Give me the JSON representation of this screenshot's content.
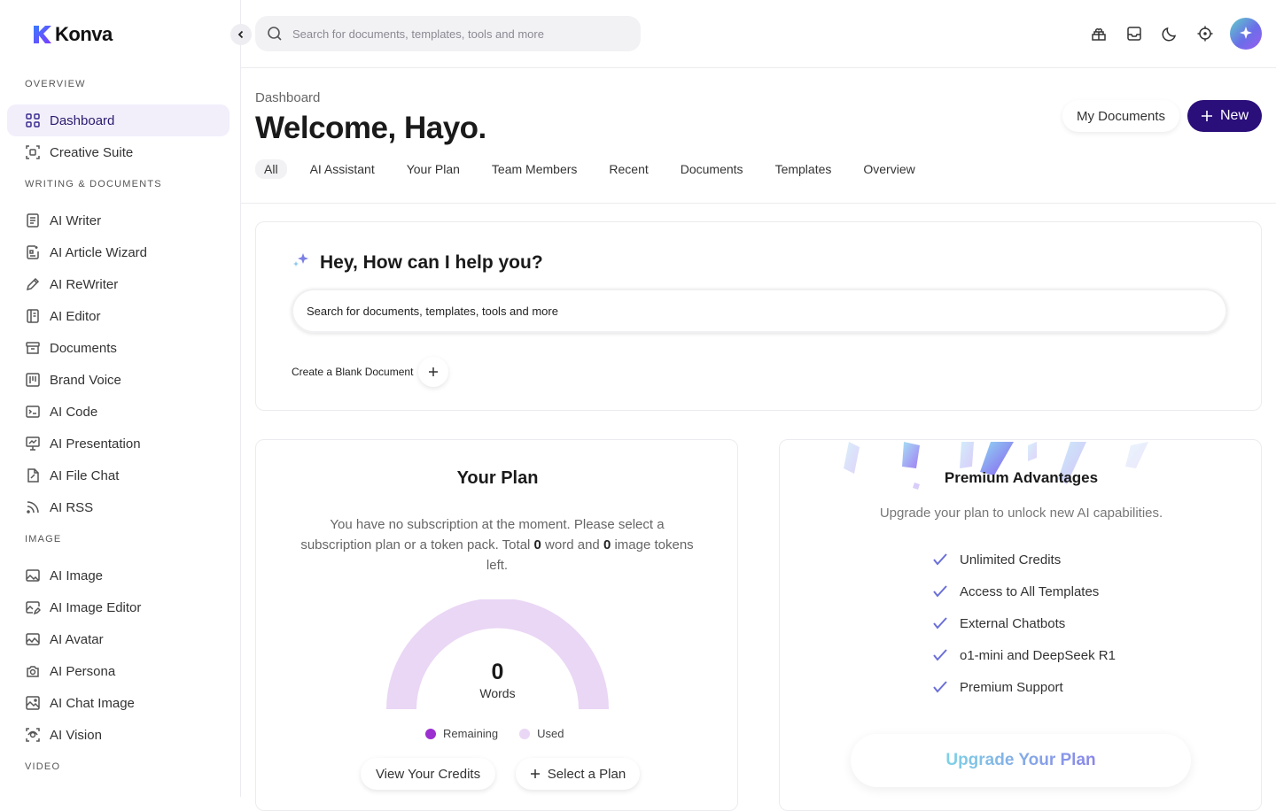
{
  "app": {
    "name": "Konva"
  },
  "sidebar": {
    "sections": [
      {
        "label": "OVERVIEW"
      },
      {
        "label": "WRITING & DOCUMENTS"
      },
      {
        "label": "IMAGE"
      },
      {
        "label": "VIDEO"
      }
    ],
    "items": [
      {
        "label": "Dashboard",
        "icon": "grid-icon"
      },
      {
        "label": "Creative Suite",
        "icon": "creative-suite-icon"
      },
      {
        "label": "AI Writer",
        "icon": "document-icon"
      },
      {
        "label": "AI Article Wizard",
        "icon": "article-icon"
      },
      {
        "label": "AI ReWriter",
        "icon": "pen-icon"
      },
      {
        "label": "AI Editor",
        "icon": "editor-icon"
      },
      {
        "label": "Documents",
        "icon": "archive-icon"
      },
      {
        "label": "Brand Voice",
        "icon": "columns-icon"
      },
      {
        "label": "AI Code",
        "icon": "terminal-icon"
      },
      {
        "label": "AI Presentation",
        "icon": "presentation-icon"
      },
      {
        "label": "AI File Chat",
        "icon": "file-chat-icon"
      },
      {
        "label": "AI RSS",
        "icon": "rss-icon"
      },
      {
        "label": "AI Image",
        "icon": "image-icon"
      },
      {
        "label": "AI Image Editor",
        "icon": "image-edit-icon"
      },
      {
        "label": "AI Avatar",
        "icon": "avatar-image-icon"
      },
      {
        "label": "AI Persona",
        "icon": "persona-icon"
      },
      {
        "label": "AI Chat Image",
        "icon": "chat-image-icon"
      },
      {
        "label": "AI Vision",
        "icon": "vision-scan-icon"
      }
    ]
  },
  "header": {
    "search_placeholder": "Search for documents, templates, tools and more"
  },
  "main": {
    "breadcrumb": "Dashboard",
    "title": "Welcome, Hayo.",
    "my_documents": "My Documents",
    "new_label": "New",
    "tabs": [
      "All",
      "AI Assistant",
      "Your Plan",
      "Team Members",
      "Recent",
      "Documents",
      "Templates",
      "Overview"
    ]
  },
  "assistant": {
    "title": "Hey, How can I help you?",
    "input_placeholder": "Search for documents, templates, tools and more",
    "blank_doc": "Create a Blank Document"
  },
  "plan": {
    "title": "Your Plan",
    "desc_a": "You have no subscription at the moment. Please select a subscription plan or a token pack. Total ",
    "word_tokens": "0",
    "desc_b": " word and ",
    "image_tokens": "0",
    "desc_c": " image tokens left.",
    "gauge_value": "0",
    "gauge_label": "Words",
    "legend_remaining": "Remaining",
    "legend_used": "Used",
    "view_credits": "View Your Credits",
    "select_plan": "Select a Plan",
    "colors": {
      "remaining": "#9b2fd0",
      "used": "#ead6f5"
    }
  },
  "premium": {
    "title": "Premium Advantages",
    "subtitle": "Upgrade your plan to unlock new AI capabilities.",
    "features": [
      "Unlimited Credits",
      "Access to All Templates",
      "External Chatbots",
      "o1-mini and DeepSeek R1",
      "Premium Support"
    ],
    "upgrade": "Upgrade Your Plan"
  }
}
